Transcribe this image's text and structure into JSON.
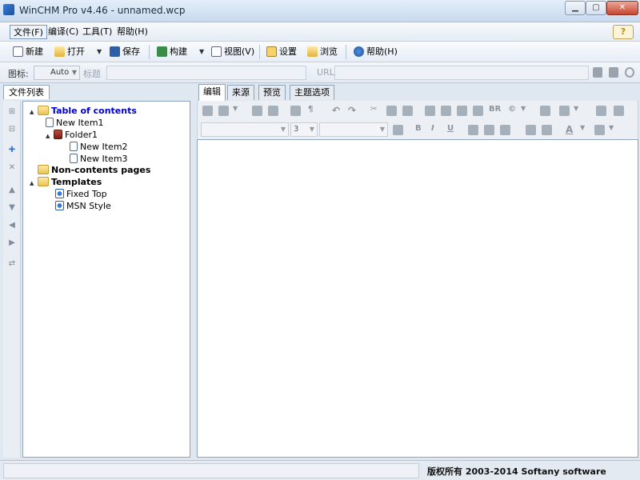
{
  "window": {
    "title": "WinCHM Pro v4.46 - unnamed.wcp"
  },
  "menubar": {
    "items": [
      "文件(F)",
      "编译(C)",
      "工具(T)",
      "帮助(H)"
    ],
    "help_badge": "?"
  },
  "toolbar": {
    "new_label": "新建",
    "open_label": "打开",
    "save_label": "保存",
    "build_label": "构建",
    "view_label": "视图(V)",
    "settings_label": "设置",
    "browse_label": "浏览",
    "help_label": "帮助(H)"
  },
  "propbar": {
    "icon_label": "图标:",
    "icon_value": "Auto",
    "title_label": "标题",
    "url_label": "URL:"
  },
  "left_panel": {
    "tab_label": "文件列表",
    "tree": [
      {
        "label": "Table of contents",
        "kind": "folder",
        "level": 0,
        "toggle": "▲",
        "style": "toc"
      },
      {
        "label": "New Item1",
        "kind": "page",
        "level": 1,
        "toggle": "",
        "style": ""
      },
      {
        "label": "Folder1",
        "kind": "book",
        "level": 1,
        "toggle": "▲",
        "style": ""
      },
      {
        "label": "New Item2",
        "kind": "page",
        "level": 2,
        "toggle": "",
        "style": ""
      },
      {
        "label": "New Item3",
        "kind": "page",
        "level": 2,
        "toggle": "",
        "style": ""
      },
      {
        "label": "Non-contents pages",
        "kind": "folder",
        "level": 0,
        "toggle": "",
        "style": "bold"
      },
      {
        "label": "Templates",
        "kind": "folder",
        "level": 0,
        "toggle": "▲",
        "style": "bold"
      },
      {
        "label": "Fixed Top",
        "kind": "template",
        "level": 1,
        "toggle": "",
        "style": ""
      },
      {
        "label": "MSN Style",
        "kind": "template",
        "level": 1,
        "toggle": "",
        "style": ""
      }
    ]
  },
  "right_panel": {
    "tabs": [
      "编辑",
      "来源",
      "预览",
      "主题选项"
    ],
    "active_tab": "编辑",
    "font_size_value": "3",
    "br_label": "BR"
  },
  "statusbar": {
    "text": "版权所有 2003-2014 Softany software"
  }
}
